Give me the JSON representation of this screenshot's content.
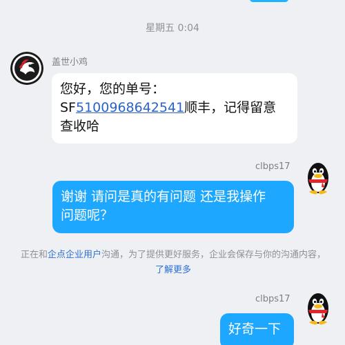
{
  "conversation": {
    "timestamp": "星期五 0:04",
    "messages": [
      {
        "sender": "盖世小鸡",
        "side": "left",
        "text_line1": "您好，您的单号：",
        "text_prefix": "SF",
        "order_number": "5100968642541",
        "text_suffix": "顺丰，记得留意",
        "text_line3": "查收哈"
      },
      {
        "sender": "clbps17",
        "side": "right",
        "text_line1": "谢谢 请问是真的有问题 还是我操作",
        "text_line2": "问题呢？"
      },
      {
        "sender": "clbps17",
        "side": "right",
        "text": "好奇一下"
      }
    ]
  },
  "notice": {
    "prefix": "正在和",
    "company_link": "企点企业用户",
    "middle": "沟通，为了提供更好服务，企业会保存与你的沟通内容，",
    "learn_more_link": "了解更多"
  },
  "colors": {
    "background": "#eef0f3",
    "sent_bubble": "#1ea7ff",
    "received_bubble": "#ffffff",
    "link": "#2c6fd6"
  },
  "icons": {
    "left_avatar": "rooster-logo-icon",
    "right_avatar": "qq-penguin-icon"
  }
}
